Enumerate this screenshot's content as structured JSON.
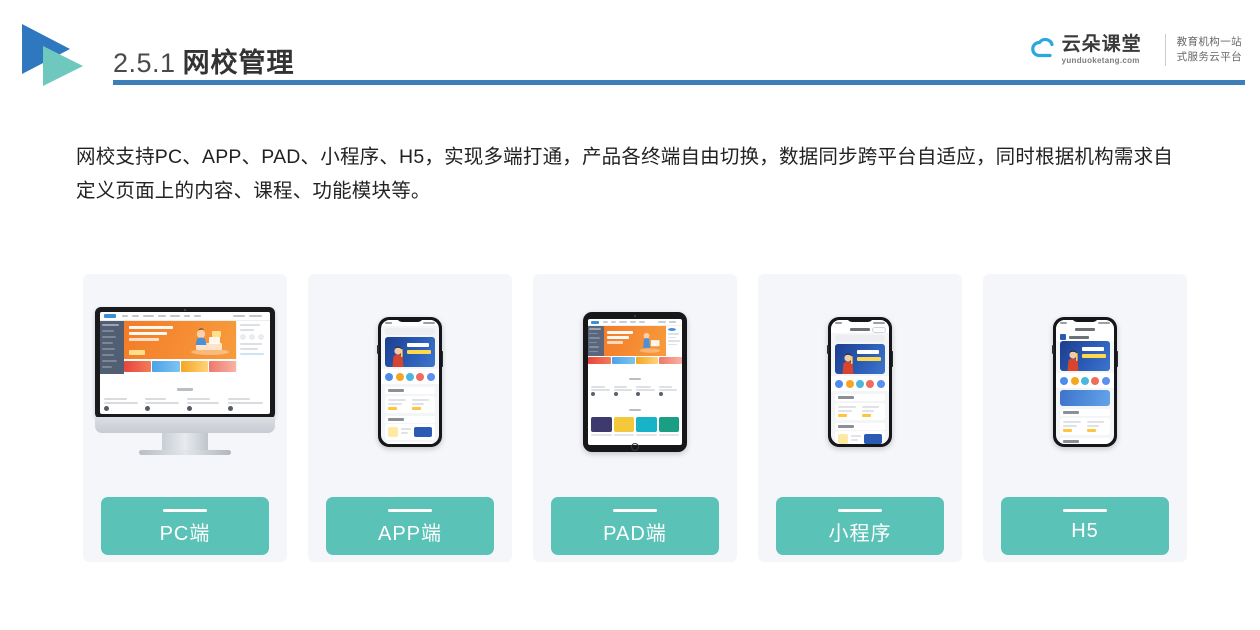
{
  "header": {
    "section_number": "2.5.1",
    "title": "网校管理",
    "rule_color": "#3C7FB8",
    "logo_triangle_blue": "#2F77BE",
    "logo_triangle_teal": "#6FC8BD"
  },
  "brand": {
    "name_cn": "云朵课堂",
    "domain": "yunduoketang.com",
    "tagline_line1": "教育机构一站",
    "tagline_line2": "式服务云平台",
    "cloud_color": "#2BA7E0"
  },
  "body": {
    "paragraph": "网校支持PC、APP、PAD、小程序、H5，实现多端打通，产品各终端自由切换，数据同步跨平台自适应，同时根据机构需求自定义页面上的内容、课程、功能模块等。"
  },
  "cards": {
    "tag_color": "#5BC2B7",
    "card_bg": "#F4F6FA",
    "items": [
      {
        "id": "pc",
        "label": "PC端",
        "device": "desktop-monitor"
      },
      {
        "id": "app",
        "label": "APP端",
        "device": "smartphone"
      },
      {
        "id": "pad",
        "label": "PAD端",
        "device": "tablet"
      },
      {
        "id": "miniapp",
        "label": "小程序",
        "device": "smartphone"
      },
      {
        "id": "h5",
        "label": "H5",
        "device": "smartphone"
      }
    ]
  }
}
